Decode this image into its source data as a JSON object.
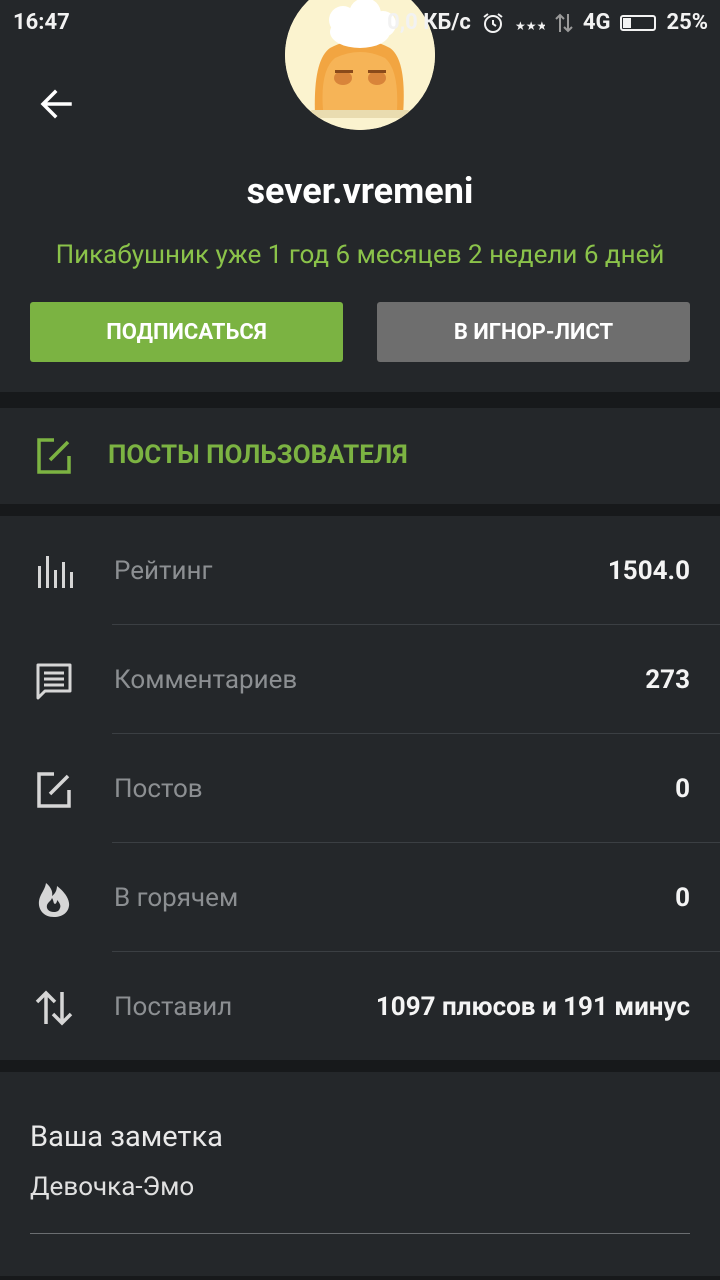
{
  "status_bar": {
    "time": "16:47",
    "net_speed": "0,0 КБ/с",
    "network": "4G",
    "battery": "25%",
    "battery_level": 0.25
  },
  "profile": {
    "username": "sever.vremeni",
    "since": "Пикабушник уже 1 год 6 месяцев 2 недели 6 дней",
    "subscribe_label": "Подписаться",
    "ignore_label": "В игнор-лист"
  },
  "posts_link": {
    "label": "Посты пользователя"
  },
  "stats": [
    {
      "icon": "bar-chart-icon",
      "label": "Рейтинг",
      "value": "1504.0"
    },
    {
      "icon": "comment-icon",
      "label": "Комментариев",
      "value": "273"
    },
    {
      "icon": "edit-icon",
      "label": "Постов",
      "value": "0"
    },
    {
      "icon": "fire-icon",
      "label": "В горячем",
      "value": "0"
    },
    {
      "icon": "swap-vert-icon",
      "label": "Поставил",
      "value": "1097 плюсов и 191 минус"
    }
  ],
  "note": {
    "title": "Ваша заметка",
    "text": "Девочка-Эмо"
  },
  "colors": {
    "accent": "#7cb342",
    "since_text": "#8bc34a",
    "panel": "#24272a",
    "background": "#17191b",
    "ignore_button": "#6e6e6e"
  }
}
